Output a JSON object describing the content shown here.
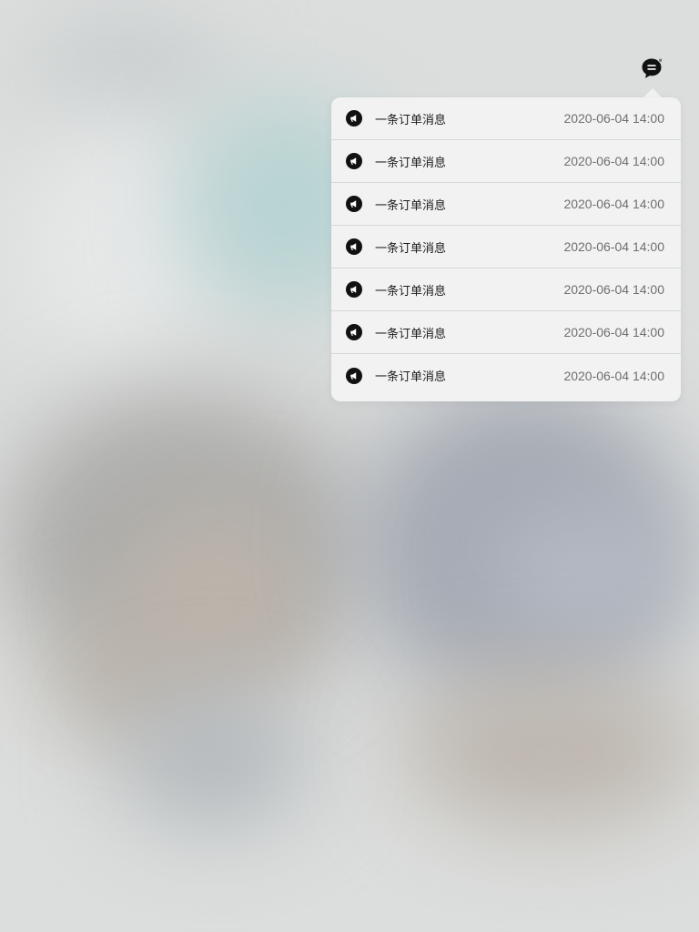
{
  "header": {
    "message_icon": "chat-bubble-icon",
    "has_unread_dot": true
  },
  "notifications": {
    "icon": "megaphone-icon",
    "items": [
      {
        "title": "一条订单消息",
        "time": "2020-06-04 14:00"
      },
      {
        "title": "一条订单消息",
        "time": "2020-06-04 14:00"
      },
      {
        "title": "一条订单消息",
        "time": "2020-06-04 14:00"
      },
      {
        "title": "一条订单消息",
        "time": "2020-06-04 14:00"
      },
      {
        "title": "一条订单消息",
        "time": "2020-06-04 14:00"
      },
      {
        "title": "一条订单消息",
        "time": "2020-06-04 14:00"
      },
      {
        "title": "一条订单消息",
        "time": "2020-06-04 14:00"
      }
    ]
  },
  "colors": {
    "popover_bg": "#f1f2f1",
    "divider": "#d7d8d8",
    "title_text": "#1c1c1c",
    "time_text": "#6f6f6f",
    "icon": "#111111"
  }
}
